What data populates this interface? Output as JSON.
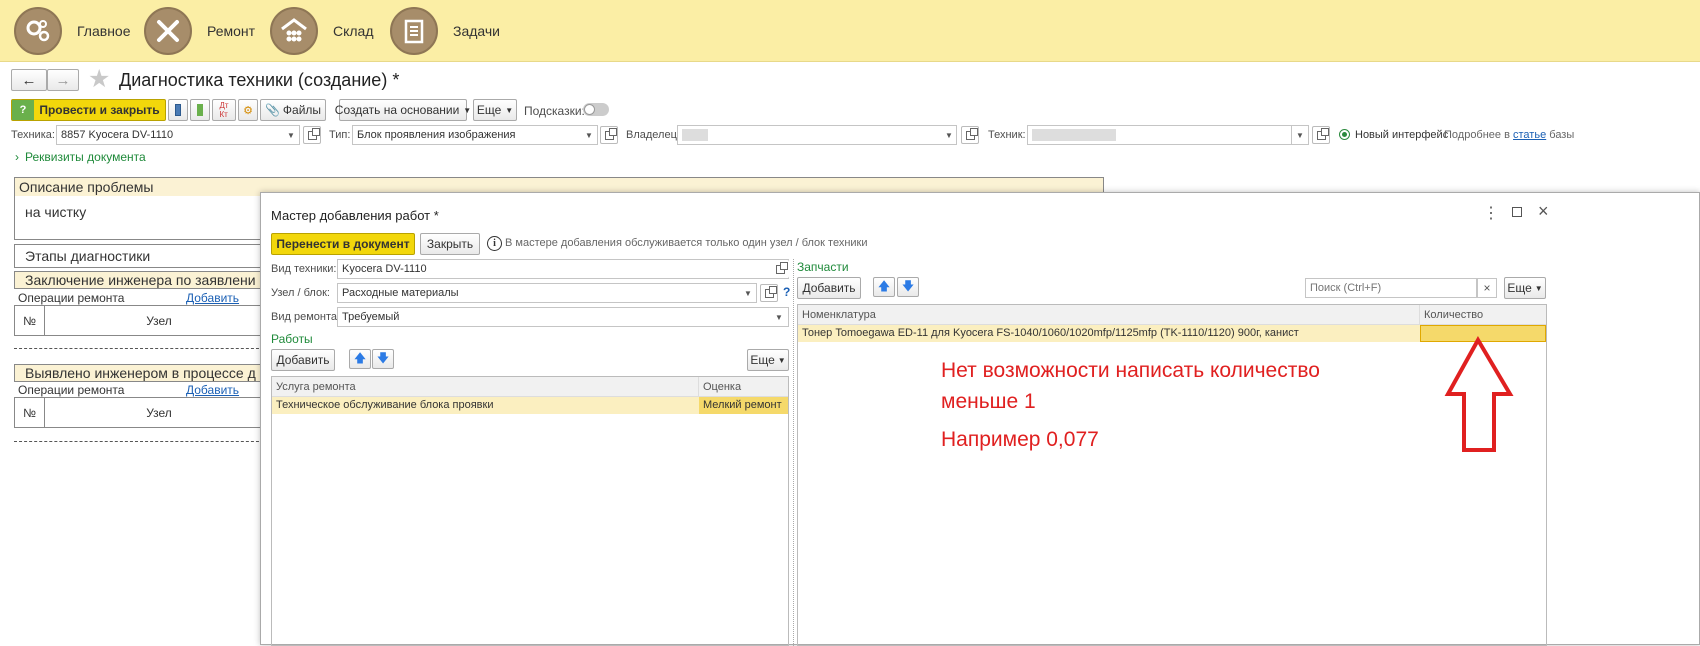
{
  "sections": [
    {
      "label": "Главное",
      "icon": "gears-icon"
    },
    {
      "label": "Ремонт",
      "icon": "tools-icon"
    },
    {
      "label": "Склад",
      "icon": "warehouse-icon"
    },
    {
      "label": "Задачи",
      "icon": "tasks-icon"
    }
  ],
  "document": {
    "title": "Диагностика техники (создание) *",
    "post_close": "Провести и закрыть",
    "files": "Файлы",
    "create_based": "Создать на основании",
    "more": "Еще",
    "hints_label": "Подсказки:",
    "tech_label": "Техника:",
    "tech_value": "8857 Kyocera DV-1110",
    "type_label": "Тип:",
    "type_value": "Блок проявления изображения",
    "owner_label": "Владелец:",
    "technician_label": "Техник:",
    "new_interface": "Новый интерфейс",
    "details_prefix": "Подробнее в",
    "details_link": "статье",
    "details_suffix": "базы",
    "requisites": "Реквизиты документа",
    "problem_header": "Описание проблемы",
    "problem_text": "на чистку",
    "stages": "Этапы диагностики",
    "conclusion": "Заключение инженера по заявлени",
    "ops_label": "Операции ремонта",
    "add": "Добавить",
    "col_no": "№",
    "col_node": "Узел",
    "found": "Выявлено инженером в процессе д"
  },
  "dialog": {
    "title": "Мастер добавления работ *",
    "transfer": "Перенести в документ",
    "close": "Закрыть",
    "info": "В мастере добавления обслуживается только один узел / блок техники",
    "kind_label": "Вид техники:",
    "kind_value": "Kyocera DV-1110",
    "node_label": "Узел / блок:",
    "node_value": "Расходные материалы",
    "repair_label": "Вид ремонта:",
    "repair_value": "Требуемый",
    "works": "Работы",
    "add": "Добавить",
    "more": "Еще",
    "col_service": "Услуга ремонта",
    "col_rating": "Оценка",
    "row_service": "Техническое обслуживание блока проявки",
    "row_rating": "Мелкий ремонт",
    "parts": "Запчасти",
    "search_placeholder": "Поиск (Ctrl+F)",
    "col_nomen": "Номенклатура",
    "col_qty": "Количество",
    "row_nomen": "Тонер Tomoegawa ED-11 для Kyocera FS-1040/1060/1020mfp/1125mfp (TK-1110/1120) 900г, канист",
    "help": "?"
  },
  "annotation": {
    "line1": "Нет возможности написать количество",
    "line2": "меньше 1",
    "line3": "Например 0,077",
    "color": "#e02020"
  }
}
